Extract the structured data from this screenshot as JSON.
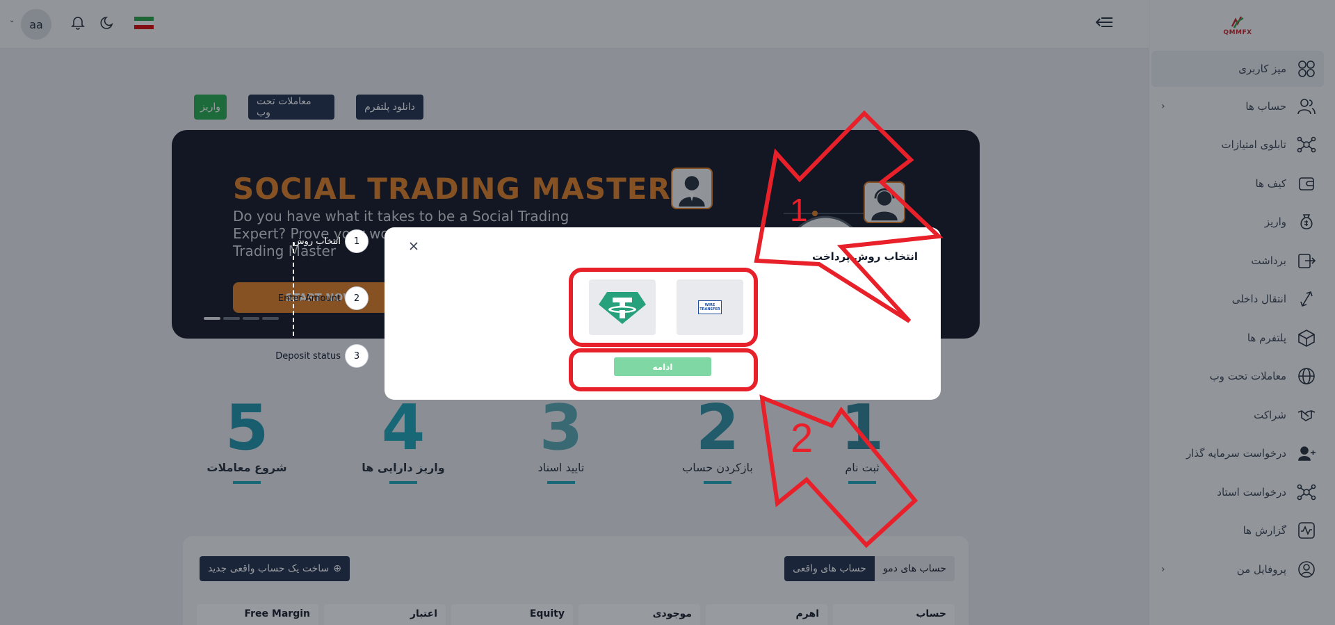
{
  "brand": {
    "name": "QMMFX"
  },
  "sidebar": {
    "items": [
      {
        "label": "میز کاربری",
        "icon": "dashboard-icon",
        "chevron": false
      },
      {
        "label": "حساب ها",
        "icon": "users-icon",
        "chevron": true
      },
      {
        "label": "تابلوی امتیازات",
        "icon": "network-icon",
        "chevron": false
      },
      {
        "label": "کیف ها",
        "icon": "wallet-icon",
        "chevron": false
      },
      {
        "label": "واریز",
        "icon": "money-bag-icon",
        "chevron": false
      },
      {
        "label": "برداشت",
        "icon": "withdraw-icon",
        "chevron": false
      },
      {
        "label": "انتقال داخلی",
        "icon": "transfer-icon",
        "chevron": false
      },
      {
        "label": "پلتفرم ها",
        "icon": "box-icon",
        "chevron": false
      },
      {
        "label": "معاملات تحت وب",
        "icon": "globe-icon",
        "chevron": false
      },
      {
        "label": "شراکت",
        "icon": "handshake-icon",
        "chevron": false
      },
      {
        "label": "درخواست سرمایه گذار",
        "icon": "user-request-icon",
        "chevron": false
      },
      {
        "label": "درخواست استاد",
        "icon": "network-icon",
        "chevron": false
      },
      {
        "label": "گزارش ها",
        "icon": "report-icon",
        "chevron": false
      },
      {
        "label": "پروفایل من",
        "icon": "profile-icon",
        "chevron": true
      }
    ]
  },
  "header": {
    "avatar_initials": "aa"
  },
  "toolbar": {
    "deposit_label": "واریز",
    "webtrade_label": "معاملات تحت وب",
    "download_label": "دانلود پلتفرم"
  },
  "banner": {
    "title": "SOCIAL TRADING MASTER",
    "subtitle": "Do you have what it takes to be a Social Trading Expert? Prove your worth by becoming a Social Trading Master",
    "cta": "START NOW"
  },
  "steps": [
    {
      "num": "1",
      "label": "ثبت نام",
      "color": "#2a7f92"
    },
    {
      "num": "2",
      "label": "بازکردن حساب",
      "color": "#2a8fa0"
    },
    {
      "num": "3",
      "label": "تایید اسناد",
      "color": "#54a8b2"
    },
    {
      "num": "4",
      "label": "واریز دارایی ها",
      "color": "#17a2b8"
    },
    {
      "num": "5",
      "label": "شروع معاملات",
      "color": "#1a93a8"
    }
  ],
  "accounts": {
    "tab_demo": "حساب های دمو",
    "tab_real": "حساب های واقعی",
    "new_button": "ساخت یک حساب واقعی جدید",
    "columns": [
      "حساب",
      "اهرم",
      "موجودی",
      "Equity",
      "اعتبار",
      "Free Margin"
    ]
  },
  "modal": {
    "title": "انتخاب روش پرداخت",
    "continue_label": "ادامه",
    "options": [
      {
        "name": "wire-transfer-option",
        "label": "WIRE TRANSFER"
      },
      {
        "name": "tether-option",
        "label": ""
      }
    ]
  },
  "stepper": {
    "steps": [
      {
        "num": "1",
        "label": "انتخاب روش"
      },
      {
        "num": "2",
        "label": "Enter Amount"
      },
      {
        "num": "3",
        "label": "Deposit status"
      }
    ]
  },
  "annotations": {
    "arrow1_label": "1",
    "arrow2_label": "2",
    "color": "#e8202a"
  },
  "colors": {
    "primary_dark": "#1d2b48",
    "green": "#22a94a",
    "accent_orange": "#e07a1f",
    "teal": "#17a2b8",
    "tether": "#26a17b"
  }
}
